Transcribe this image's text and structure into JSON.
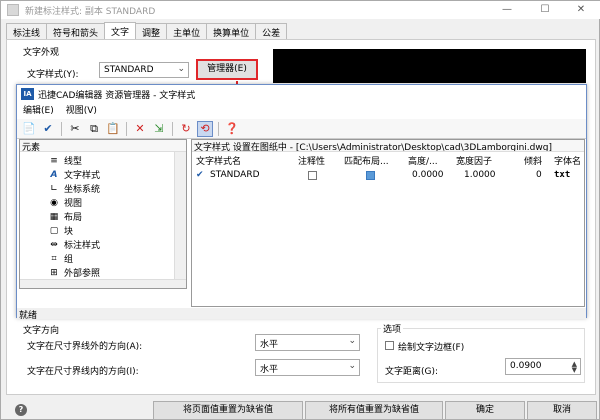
{
  "window": {
    "title": "新建标注样式: 副本 STANDARD",
    "minimize": "—",
    "maximize": "☐",
    "close": "✕"
  },
  "tabs": [
    "标注线",
    "符号和箭头",
    "文字",
    "调整",
    "主单位",
    "换算单位",
    "公差"
  ],
  "active_tab": 2,
  "text_appearance": {
    "group_label": "文字外观",
    "style_label": "文字样式(Y):",
    "style_value": "STANDARD",
    "manager_button": "管理器(E)"
  },
  "manager_dialog": {
    "title": "迅捷CAD编辑器 资源管理器 - 文字样式",
    "icon_text": "IA",
    "menu": [
      "编辑(E)",
      "视图(V)"
    ],
    "tree_header": "元素",
    "tree_items": [
      "线型",
      "文字样式",
      "坐标系统",
      "视图",
      "布局",
      "块",
      "标注样式",
      "组",
      "外部参照"
    ],
    "list_header": "文字样式  设置在图纸中 - [C:\\Users\\Administrator\\Desktop\\cad\\3DLamborgini.dwg]",
    "columns": [
      "文字样式名",
      "注释性",
      "匹配布局...",
      "高度/...",
      "宽度因子",
      "倾斜",
      "字体名"
    ],
    "row": {
      "name": "STANDARD",
      "height": "0.0000",
      "width": "1.0000",
      "oblique": "0",
      "font": "txt"
    },
    "status": "就绪"
  },
  "text_direction": {
    "group_label": "文字方向",
    "outside_label": "文字在尺寸界线外的方向(A):",
    "outside_value": "水平",
    "inside_label": "文字在尺寸界线内的方向(I):",
    "inside_value": "水平"
  },
  "options": {
    "group_label": "选项",
    "frame_label": "绘制文字边框(F)",
    "offset_label": "文字距离(G):",
    "offset_value": "0.0900"
  },
  "footer": {
    "help": "?",
    "reset_page": "将页面值重置为缺省值",
    "reset_all": "将所有值重置为缺省值",
    "ok": "确定",
    "cancel": "取消"
  }
}
